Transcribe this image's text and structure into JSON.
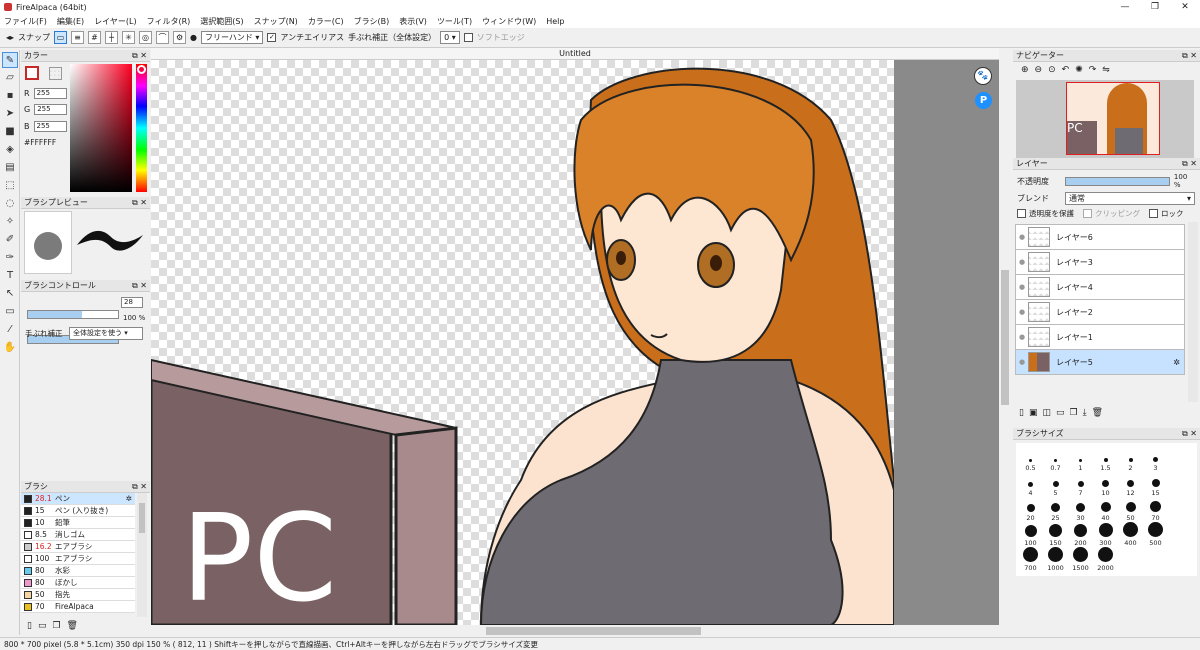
{
  "window": {
    "title": "FireAlpaca (64bit)",
    "minimize": "—",
    "maximize": "❐",
    "close": "✕"
  },
  "menu": [
    "ファイル(F)",
    "編集(E)",
    "レイヤー(L)",
    "フィルタ(R)",
    "選択範囲(S)",
    "スナップ(N)",
    "カラー(C)",
    "ブラシ(B)",
    "表示(V)",
    "ツール(T)",
    "ウィンドウ(W)",
    "Help"
  ],
  "toolbar": {
    "prev": "◂▸",
    "snap_label": "スナップ",
    "brush_mode": "フリーハンド",
    "antialias_label": "アンチエイリアス",
    "antialias_checked": "✓",
    "stabilizer_label": "手ぶれ補正（全体設定）",
    "stabilizer_value": "0",
    "soft_edge_label": "ソフトエッジ"
  },
  "color_panel": {
    "title": "カラー",
    "r_label": "R",
    "r_value": "255",
    "g_label": "G",
    "g_value": "255",
    "b_label": "B",
    "b_value": "255",
    "hex": "#FFFFFF"
  },
  "brush_preview": {
    "title": "ブラシプレビュー"
  },
  "brush_control": {
    "title": "ブラシコントロール",
    "size_value": "28",
    "opacity_value": "100 %",
    "stabilizer_label": "手ぶれ補正",
    "stabilizer_option": "全体設定を使う",
    "size_fraction": 0.6,
    "opacity_fraction": 1.0
  },
  "brush_list": {
    "title": "ブラシ",
    "items": [
      {
        "size": "28.1",
        "name": "ペン",
        "color": "#222222",
        "size_color": "#d22"
      },
      {
        "size": "15",
        "name": "ペン (入り抜き)",
        "color": "#222222",
        "size_color": "#222"
      },
      {
        "size": "10",
        "name": "鉛筆",
        "color": "#222222",
        "size_color": "#222"
      },
      {
        "size": "8.5",
        "name": "消しゴム",
        "color": "#ffffff",
        "size_color": "#222"
      },
      {
        "size": "16.2",
        "name": "エアブラシ",
        "color": "#cccccc",
        "size_color": "#d22"
      },
      {
        "size": "100",
        "name": "エアブラシ",
        "color": "#ffffff",
        "size_color": "#222"
      },
      {
        "size": "80",
        "name": "水彩",
        "color": "#66ccee",
        "size_color": "#222"
      },
      {
        "size": "80",
        "name": "ぼかし",
        "color": "#ee99cc",
        "size_color": "#222"
      },
      {
        "size": "50",
        "name": "指先",
        "color": "#f5d5a0",
        "size_color": "#222"
      },
      {
        "size": "70",
        "name": "FireAlpaca",
        "color": "#e8c020",
        "size_color": "#222"
      }
    ]
  },
  "canvas": {
    "tab_title": "Untitled",
    "text": "PC"
  },
  "navigator": {
    "title": "ナビゲーター",
    "thumb_text": "PC"
  },
  "layers": {
    "title": "レイヤー",
    "opacity_label": "不透明度",
    "opacity_value": "100 %",
    "opacity_fraction": 1.0,
    "blend_label": "ブレンド",
    "blend_value": "通常",
    "protect_alpha": "透明度を保護",
    "clipping": "クリッピング",
    "lock": "ロック",
    "items": [
      {
        "name": "レイヤー6"
      },
      {
        "name": "レイヤー3"
      },
      {
        "name": "レイヤー4"
      },
      {
        "name": "レイヤー2"
      },
      {
        "name": "レイヤー1"
      },
      {
        "name": "レイヤー5"
      }
    ]
  },
  "brush_size": {
    "title": "ブラシサイズ",
    "sizes": [
      "0.5",
      "0.7",
      "1",
      "1.5",
      "2",
      "3",
      "4",
      "5",
      "7",
      "10",
      "12",
      "15",
      "20",
      "25",
      "30",
      "40",
      "50",
      "70",
      "100",
      "150",
      "200",
      "300",
      "400",
      "500",
      "700",
      "1000",
      "1500",
      "2000"
    ]
  },
  "status": {
    "text": "800 * 700 pixel   (5.8 * 5.1cm)   350 dpi   150 %   ( 812, 11 )   Shiftキーを押しながらで直線描画、Ctrl+Altキーを押しながら左右ドラッグでブラシサイズ変更"
  }
}
